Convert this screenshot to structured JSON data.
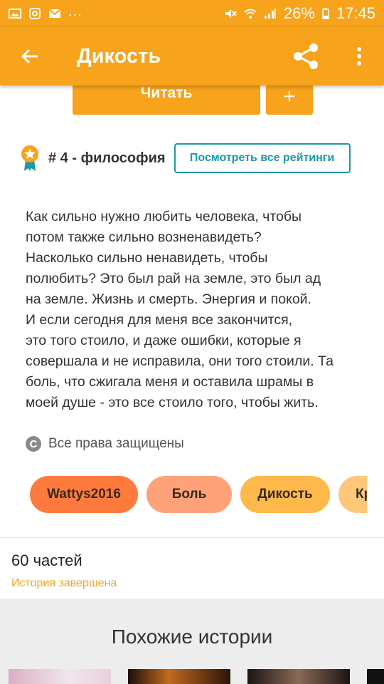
{
  "status_bar": {
    "battery": "26%",
    "time": "17:45",
    "left_icons": [
      "image-icon",
      "instagram-icon",
      "mail-icon",
      "more-dots-icon"
    ],
    "right_icons": [
      "mute-icon",
      "wifi-icon",
      "signal-icon",
      "battery-icon"
    ],
    "dots": "..."
  },
  "app_bar": {
    "title": "Дикость",
    "back_icon": "arrow-back-icon",
    "share_icon": "share-icon",
    "more_icon": "more-vert-icon"
  },
  "actions": {
    "read_label": "Читать",
    "add_label": "+"
  },
  "ranking": {
    "text": "# 4 - философия",
    "button_label": "Посмотреть все рейтинги"
  },
  "description": "Как сильно нужно любить человека, чтобы\nпотом также сильно  возненавидеть?\nНасколько сильно ненавидеть, чтобы\nполюбить? Это был рай на земле, это был ад\nна земле.  Жизнь и смерть. Энергия и покой.\nИ если сегодня для меня все закончится,\nэто того стоило, и даже ошибки, которые я\nсовершала и не исправила, они того стоили. Та\nболь, что сжигала меня и оставила шрамы в\nмоей душе - это все стоило того, чтобы жить.",
  "copyright": {
    "icon": "C",
    "text": "Все права защищены"
  },
  "tags": [
    "Wattys2016",
    "Боль",
    "Дикость",
    "Кр"
  ],
  "parts": {
    "count_label": "60 частей",
    "status": "История завершена"
  },
  "similar": {
    "title": "Похожие истории"
  },
  "colors": {
    "accent": "#f7a31b",
    "teal": "#1b9aa6"
  }
}
